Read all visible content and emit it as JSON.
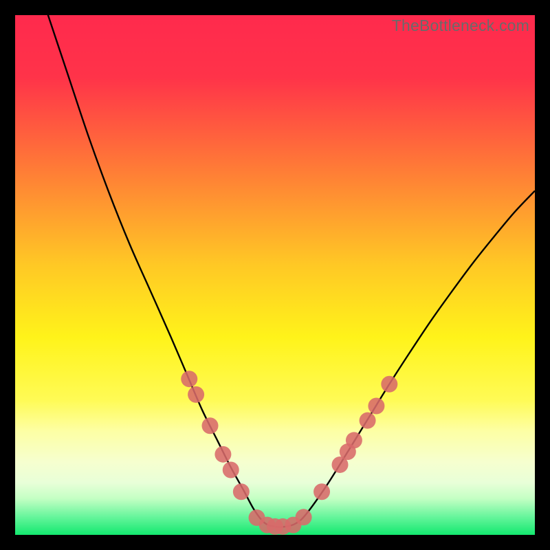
{
  "watermark": "TheBottleneck.com",
  "chart_data": {
    "type": "line",
    "title": "",
    "xlabel": "",
    "ylabel": "",
    "xlim": [
      0,
      100
    ],
    "ylim": [
      0,
      100
    ],
    "gradient_stops": [
      {
        "offset": 0.0,
        "color": "#ff2a4d"
      },
      {
        "offset": 0.12,
        "color": "#ff3349"
      },
      {
        "offset": 0.3,
        "color": "#ff7d36"
      },
      {
        "offset": 0.48,
        "color": "#ffc825"
      },
      {
        "offset": 0.62,
        "color": "#fff31a"
      },
      {
        "offset": 0.74,
        "color": "#fffb55"
      },
      {
        "offset": 0.8,
        "color": "#fdffa4"
      },
      {
        "offset": 0.86,
        "color": "#f6ffcf"
      },
      {
        "offset": 0.9,
        "color": "#e8ffd8"
      },
      {
        "offset": 0.93,
        "color": "#c4ffc4"
      },
      {
        "offset": 0.965,
        "color": "#67f59c"
      },
      {
        "offset": 1.0,
        "color": "#13e86f"
      }
    ],
    "series": [
      {
        "name": "bottleneck-curve",
        "x": [
          6,
          10,
          14,
          18,
          22,
          26,
          30,
          33,
          36,
          39,
          41.5,
          44,
          46,
          48,
          50,
          52,
          54,
          56,
          60,
          64,
          68,
          72,
          76,
          80,
          84,
          88,
          92,
          96,
          100
        ],
        "y": [
          101,
          89,
          77,
          66,
          56,
          47,
          38,
          31,
          24,
          18,
          13,
          8.5,
          4.8,
          2.3,
          1.6,
          1.6,
          2.2,
          4.0,
          9.6,
          16.0,
          22.5,
          29.0,
          35.2,
          41.2,
          46.8,
          52.2,
          57.2,
          62.0,
          66.2
        ]
      }
    ],
    "markers": {
      "name": "highlight-dots",
      "color": "#d86a6a",
      "radius": 12,
      "points": [
        {
          "x": 33.5,
          "y": 30.0
        },
        {
          "x": 34.8,
          "y": 27.0
        },
        {
          "x": 37.5,
          "y": 21.0
        },
        {
          "x": 40.0,
          "y": 15.5
        },
        {
          "x": 41.5,
          "y": 12.5
        },
        {
          "x": 43.5,
          "y": 8.3
        },
        {
          "x": 46.5,
          "y": 3.3
        },
        {
          "x": 48.5,
          "y": 1.9
        },
        {
          "x": 50.0,
          "y": 1.6
        },
        {
          "x": 51.5,
          "y": 1.6
        },
        {
          "x": 53.5,
          "y": 1.9
        },
        {
          "x": 55.5,
          "y": 3.4
        },
        {
          "x": 59.0,
          "y": 8.3
        },
        {
          "x": 62.5,
          "y": 13.5
        },
        {
          "x": 64.0,
          "y": 16.0
        },
        {
          "x": 65.2,
          "y": 18.2
        },
        {
          "x": 67.8,
          "y": 22.0
        },
        {
          "x": 69.5,
          "y": 24.8
        },
        {
          "x": 72.0,
          "y": 29.0
        }
      ]
    }
  }
}
